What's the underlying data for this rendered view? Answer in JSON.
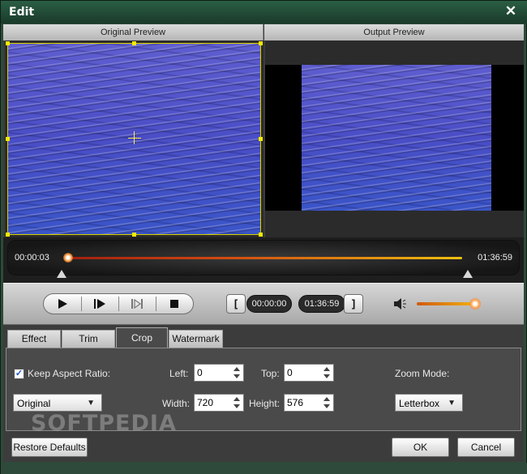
{
  "window": {
    "title": "Edit",
    "close_glyph": "✕"
  },
  "preview": {
    "original_label": "Original Preview",
    "output_label": "Output Preview"
  },
  "timeline": {
    "current_time": "00:00:03",
    "duration": "01:36:59",
    "position_fraction": 0.0
  },
  "controls": {
    "play_icon": "play-icon",
    "next_frame_icon": "next-frame-icon",
    "stop_icon": "stop-icon",
    "start_bracket": "[",
    "end_bracket": "]",
    "start_time": "00:00:00",
    "end_time": "01:36:59",
    "volume_fraction": 1.0
  },
  "tabs": [
    {
      "label": "Effect",
      "active": false
    },
    {
      "label": "Trim",
      "active": false
    },
    {
      "label": "Crop",
      "active": true
    },
    {
      "label": "Watermark",
      "active": false
    }
  ],
  "crop": {
    "keep_aspect_label": "Keep Aspect Ratio:",
    "keep_aspect_checked": true,
    "aspect_value": "Original",
    "left_label": "Left:",
    "left_value": "0",
    "top_label": "Top:",
    "top_value": "0",
    "width_label": "Width:",
    "width_value": "720",
    "height_label": "Height:",
    "height_value": "576",
    "zoom_mode_label": "Zoom Mode:",
    "zoom_mode_value": "Letterbox"
  },
  "watermark_text": "SOFTPEDIA",
  "buttons": {
    "restore": "Restore Defaults",
    "ok": "OK",
    "cancel": "Cancel"
  },
  "colors": {
    "title_bar": "#1f4a34",
    "accent_orange": "#f0a010",
    "crop_box": "#f4ec00"
  }
}
